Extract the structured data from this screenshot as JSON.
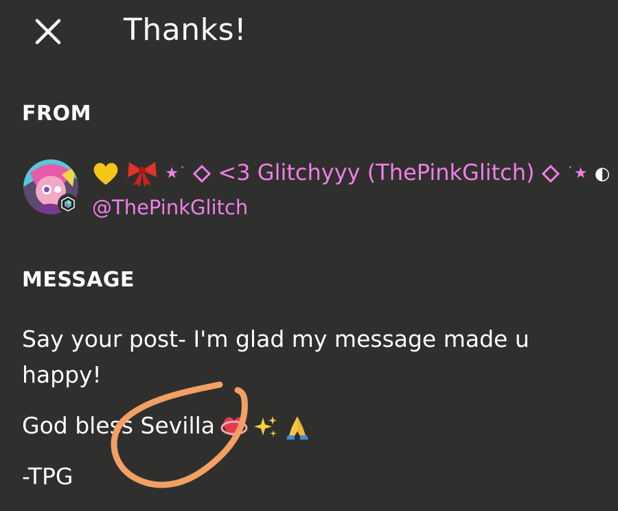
{
  "header": {
    "title": "Thanks!",
    "close_icon": "close-icon"
  },
  "from": {
    "label": "FROM",
    "display_name": "<3 Glitchyyy (ThePinkGlitch)",
    "handle": "@ThePinkGlitch",
    "name_color": "#f27ee8",
    "avatar_icon": "avatar-image",
    "badge_icon": "hexagon-badge-icon"
  },
  "message": {
    "label": "MESSAGE",
    "line1": "Say your post- I'm glad my message made u happy!",
    "line2": "God bless Sevilla",
    "line3": "-TPG"
  },
  "colors": {
    "background": "#2f302e",
    "text": "#ffffff",
    "accent_pink": "#f27ee8",
    "annotation_orange": "#f2a063"
  }
}
